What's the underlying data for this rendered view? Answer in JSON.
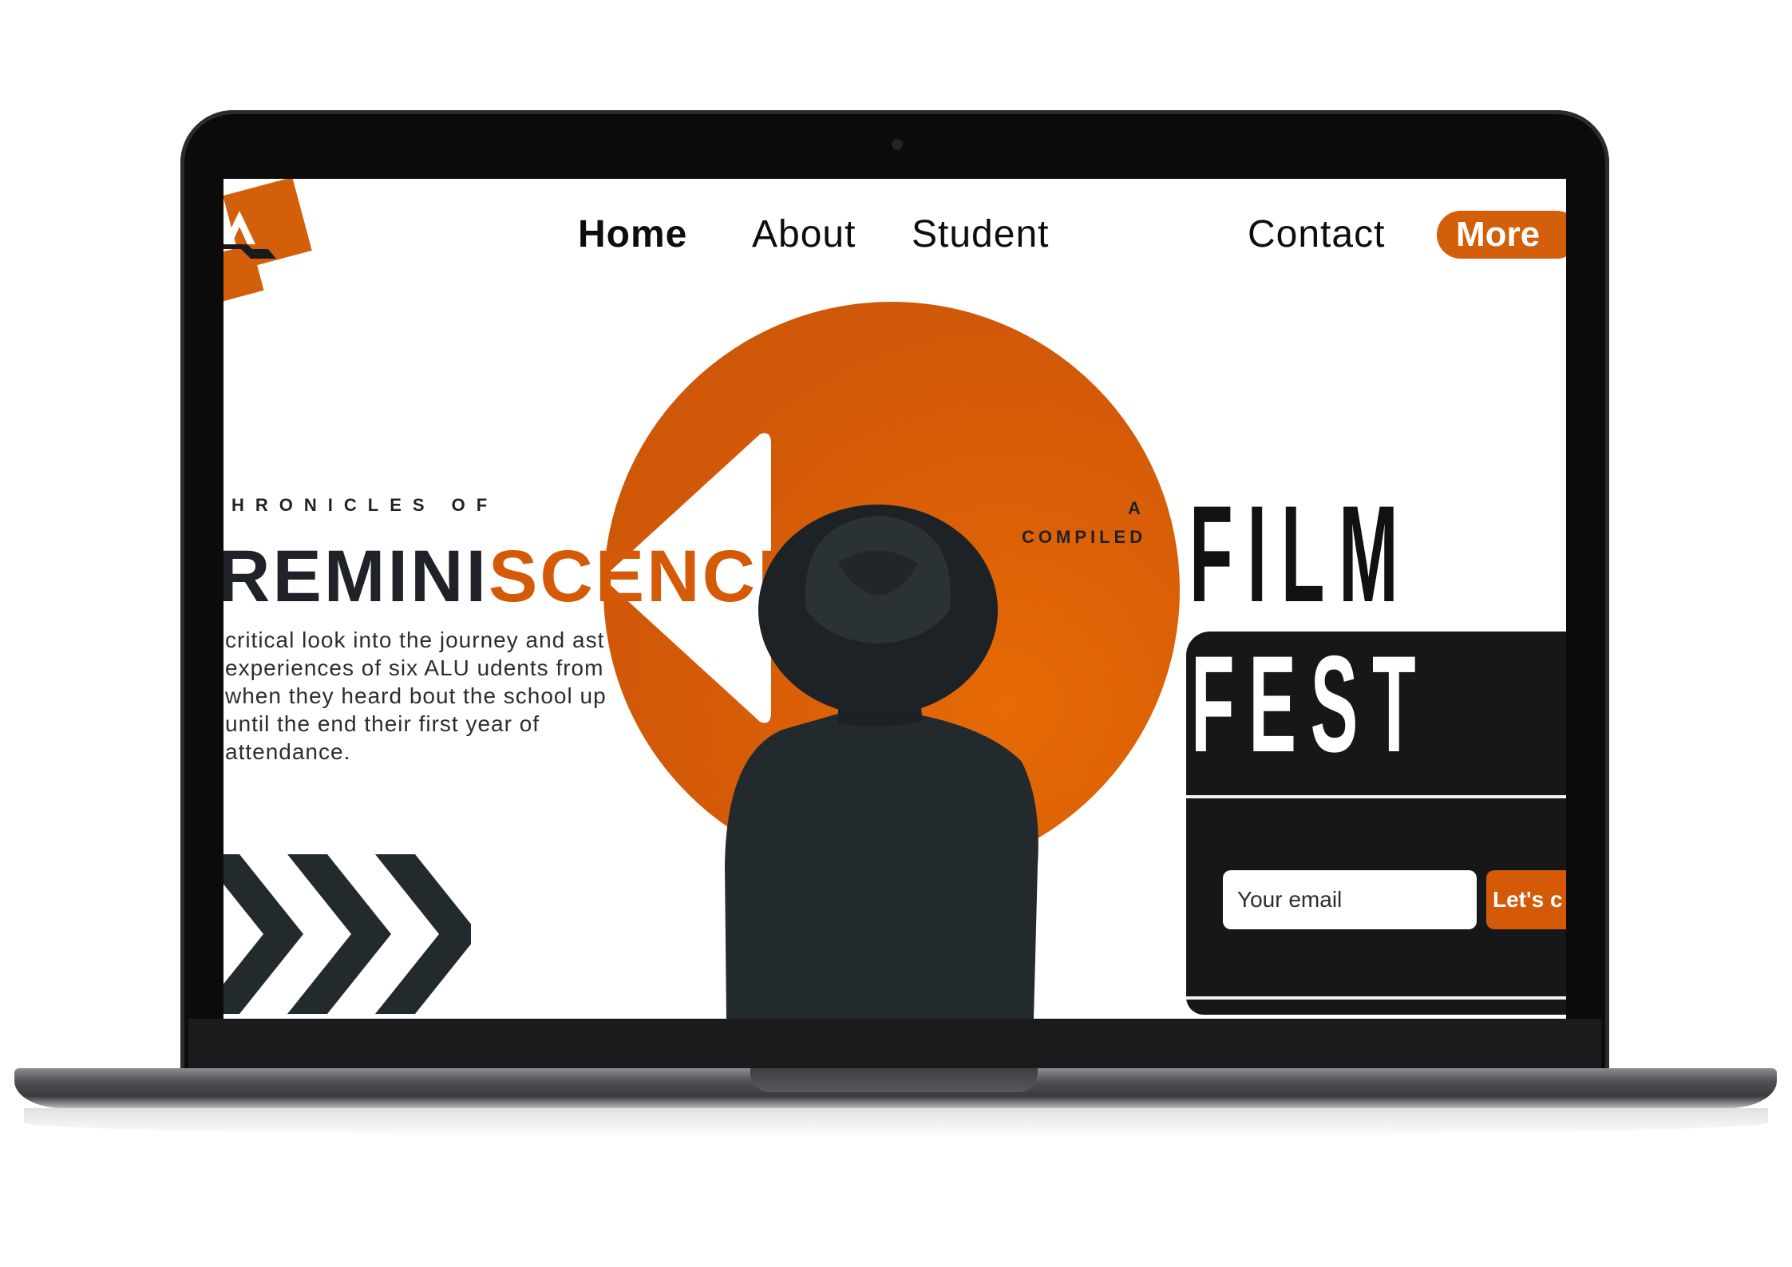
{
  "nav": {
    "home": "Home",
    "about": "About",
    "student": "Student",
    "contact": "Contact",
    "more": "More"
  },
  "hero": {
    "kicker": "HRONICLES OF",
    "title_part1": "REMINI",
    "title_part2": "SCENCE",
    "description": "critical look into the journey and ast experiences of six ALU udents from when they heard bout the school up until the end  their first year of attendance."
  },
  "tagline": {
    "a": "A",
    "compiled": "COMPILED"
  },
  "fest": {
    "film": "FILM",
    "fest": "FEST",
    "email_placeholder": "Your email",
    "cta": "Let's c"
  },
  "colors": {
    "accent": "#d45a08",
    "dark": "#161719",
    "text": "#1f2228"
  },
  "icons": [
    "logo-mark",
    "triangle-play-shape",
    "chevron-arrows"
  ]
}
